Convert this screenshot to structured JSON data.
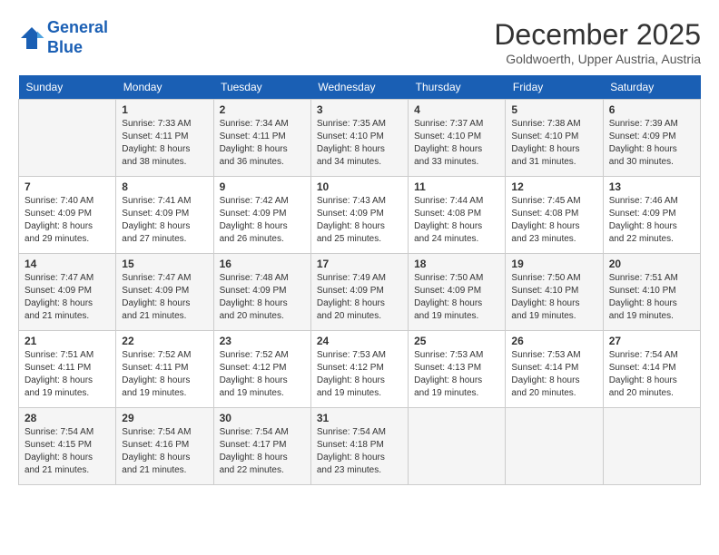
{
  "header": {
    "logo_line1": "General",
    "logo_line2": "Blue",
    "month": "December 2025",
    "location": "Goldwoerth, Upper Austria, Austria"
  },
  "days_of_week": [
    "Sunday",
    "Monday",
    "Tuesday",
    "Wednesday",
    "Thursday",
    "Friday",
    "Saturday"
  ],
  "weeks": [
    [
      {
        "num": "",
        "info": ""
      },
      {
        "num": "1",
        "info": "Sunrise: 7:33 AM\nSunset: 4:11 PM\nDaylight: 8 hours\nand 38 minutes."
      },
      {
        "num": "2",
        "info": "Sunrise: 7:34 AM\nSunset: 4:11 PM\nDaylight: 8 hours\nand 36 minutes."
      },
      {
        "num": "3",
        "info": "Sunrise: 7:35 AM\nSunset: 4:10 PM\nDaylight: 8 hours\nand 34 minutes."
      },
      {
        "num": "4",
        "info": "Sunrise: 7:37 AM\nSunset: 4:10 PM\nDaylight: 8 hours\nand 33 minutes."
      },
      {
        "num": "5",
        "info": "Sunrise: 7:38 AM\nSunset: 4:10 PM\nDaylight: 8 hours\nand 31 minutes."
      },
      {
        "num": "6",
        "info": "Sunrise: 7:39 AM\nSunset: 4:09 PM\nDaylight: 8 hours\nand 30 minutes."
      }
    ],
    [
      {
        "num": "7",
        "info": "Sunrise: 7:40 AM\nSunset: 4:09 PM\nDaylight: 8 hours\nand 29 minutes."
      },
      {
        "num": "8",
        "info": "Sunrise: 7:41 AM\nSunset: 4:09 PM\nDaylight: 8 hours\nand 27 minutes."
      },
      {
        "num": "9",
        "info": "Sunrise: 7:42 AM\nSunset: 4:09 PM\nDaylight: 8 hours\nand 26 minutes."
      },
      {
        "num": "10",
        "info": "Sunrise: 7:43 AM\nSunset: 4:09 PM\nDaylight: 8 hours\nand 25 minutes."
      },
      {
        "num": "11",
        "info": "Sunrise: 7:44 AM\nSunset: 4:08 PM\nDaylight: 8 hours\nand 24 minutes."
      },
      {
        "num": "12",
        "info": "Sunrise: 7:45 AM\nSunset: 4:08 PM\nDaylight: 8 hours\nand 23 minutes."
      },
      {
        "num": "13",
        "info": "Sunrise: 7:46 AM\nSunset: 4:09 PM\nDaylight: 8 hours\nand 22 minutes."
      }
    ],
    [
      {
        "num": "14",
        "info": "Sunrise: 7:47 AM\nSunset: 4:09 PM\nDaylight: 8 hours\nand 21 minutes."
      },
      {
        "num": "15",
        "info": "Sunrise: 7:47 AM\nSunset: 4:09 PM\nDaylight: 8 hours\nand 21 minutes."
      },
      {
        "num": "16",
        "info": "Sunrise: 7:48 AM\nSunset: 4:09 PM\nDaylight: 8 hours\nand 20 minutes."
      },
      {
        "num": "17",
        "info": "Sunrise: 7:49 AM\nSunset: 4:09 PM\nDaylight: 8 hours\nand 20 minutes."
      },
      {
        "num": "18",
        "info": "Sunrise: 7:50 AM\nSunset: 4:09 PM\nDaylight: 8 hours\nand 19 minutes."
      },
      {
        "num": "19",
        "info": "Sunrise: 7:50 AM\nSunset: 4:10 PM\nDaylight: 8 hours\nand 19 minutes."
      },
      {
        "num": "20",
        "info": "Sunrise: 7:51 AM\nSunset: 4:10 PM\nDaylight: 8 hours\nand 19 minutes."
      }
    ],
    [
      {
        "num": "21",
        "info": "Sunrise: 7:51 AM\nSunset: 4:11 PM\nDaylight: 8 hours\nand 19 minutes."
      },
      {
        "num": "22",
        "info": "Sunrise: 7:52 AM\nSunset: 4:11 PM\nDaylight: 8 hours\nand 19 minutes."
      },
      {
        "num": "23",
        "info": "Sunrise: 7:52 AM\nSunset: 4:12 PM\nDaylight: 8 hours\nand 19 minutes."
      },
      {
        "num": "24",
        "info": "Sunrise: 7:53 AM\nSunset: 4:12 PM\nDaylight: 8 hours\nand 19 minutes."
      },
      {
        "num": "25",
        "info": "Sunrise: 7:53 AM\nSunset: 4:13 PM\nDaylight: 8 hours\nand 19 minutes."
      },
      {
        "num": "26",
        "info": "Sunrise: 7:53 AM\nSunset: 4:14 PM\nDaylight: 8 hours\nand 20 minutes."
      },
      {
        "num": "27",
        "info": "Sunrise: 7:54 AM\nSunset: 4:14 PM\nDaylight: 8 hours\nand 20 minutes."
      }
    ],
    [
      {
        "num": "28",
        "info": "Sunrise: 7:54 AM\nSunset: 4:15 PM\nDaylight: 8 hours\nand 21 minutes."
      },
      {
        "num": "29",
        "info": "Sunrise: 7:54 AM\nSunset: 4:16 PM\nDaylight: 8 hours\nand 21 minutes."
      },
      {
        "num": "30",
        "info": "Sunrise: 7:54 AM\nSunset: 4:17 PM\nDaylight: 8 hours\nand 22 minutes."
      },
      {
        "num": "31",
        "info": "Sunrise: 7:54 AM\nSunset: 4:18 PM\nDaylight: 8 hours\nand 23 minutes."
      },
      {
        "num": "",
        "info": ""
      },
      {
        "num": "",
        "info": ""
      },
      {
        "num": "",
        "info": ""
      }
    ]
  ]
}
